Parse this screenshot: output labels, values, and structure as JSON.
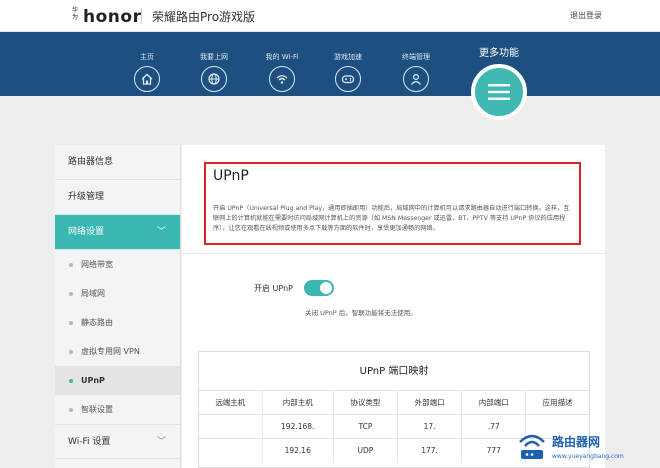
{
  "header": {
    "logo_sub": "华为",
    "logo_text": "honor",
    "product_title": "荣耀路由Pro游戏版",
    "logout_label": "退出登录"
  },
  "nav": {
    "items": [
      {
        "label": "主页",
        "icon": "home-icon"
      },
      {
        "label": "我要上网",
        "icon": "globe-icon"
      },
      {
        "label": "我的 Wi-Fi",
        "icon": "wifi-icon"
      },
      {
        "label": "游戏加速",
        "icon": "gamepad-icon"
      },
      {
        "label": "终端管理",
        "icon": "user-icon"
      }
    ],
    "more_label": "更多功能",
    "more_icon": "menu-icon"
  },
  "sidebar": {
    "router_info": "路由器信息",
    "upgrade": "升级管理",
    "network_settings": "网络设置",
    "network_settings_chevron": "﹀",
    "sub_items": [
      "网络带宽",
      "局域网",
      "静态路由",
      "虚拟专用网 VPN",
      "UPnP",
      "智联设置"
    ],
    "wifi_settings": "Wi-Fi 设置",
    "wifi_settings_chevron": "﹀"
  },
  "upnp": {
    "title": "UPnP",
    "description": "开启 UPnP（Universal Plug and Play，通用即插即用）功能后，局域网中的计算机可以请求路由器自动进行端口转换。这样，互联网上的计算机就能在需要时访问局域网计算机上的资源（如 MSN Messenger 或迅雷、BT、PPTV 等支持 UPnP 协议的应用程序），让您在观看在线视频或使用多点下载等方面的软件时，享受更加通畅的网络。",
    "toggle_label": "开启 UPnP",
    "toggle_on": true,
    "toggle_hint": "关闭 UPnP 后，智联功能将无法使用。"
  },
  "mapping": {
    "title": "UPnP 端口映射",
    "columns": [
      "远端主机",
      "内部主机",
      "协议类型",
      "外部端口",
      "内部端口",
      "应用描述"
    ],
    "rows": [
      [
        "",
        "192.168.",
        "TCP",
        "17.",
        ".77",
        ""
      ],
      [
        "",
        "192.16",
        "UDP",
        "177.",
        "777",
        ""
      ]
    ]
  },
  "watermark": {
    "text": "路由器网",
    "url": "www.yueyangbang.com"
  },
  "colors": {
    "nav_bg": "#1d4f80",
    "accent": "#3ab7b0",
    "highlight_border": "#e0202a"
  }
}
